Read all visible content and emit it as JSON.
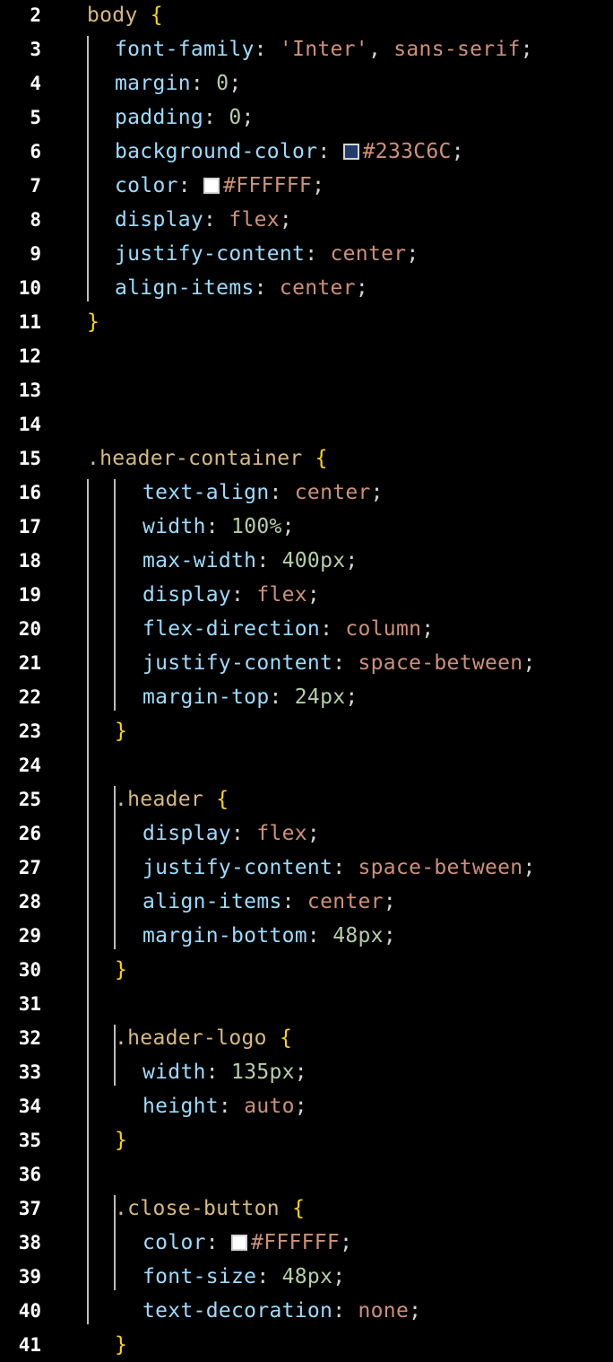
{
  "colors": {
    "background": "#000000",
    "line_number": "#ffffff",
    "selector": "#d7ba7d",
    "brace": "#ffd700",
    "property": "#9cdcfe",
    "punctuation": "#d4d4d4",
    "value": "#ce9178",
    "number": "#b5cea8",
    "guide": "#bdbdbd"
  },
  "lines": [
    {
      "n": "2",
      "indent": 0,
      "tokens": [
        {
          "t": "sel",
          "v": "body"
        },
        {
          "t": "text",
          "v": " "
        },
        {
          "t": "brace",
          "v": "{"
        }
      ]
    },
    {
      "n": "3",
      "indent": 1,
      "tokens": [
        {
          "t": "prop",
          "v": "font-family"
        },
        {
          "t": "punc",
          "v": ": "
        },
        {
          "t": "val",
          "v": "'Inter'"
        },
        {
          "t": "punc",
          "v": ", "
        },
        {
          "t": "val",
          "v": "sans-serif"
        },
        {
          "t": "punc",
          "v": ";"
        }
      ]
    },
    {
      "n": "4",
      "indent": 1,
      "tokens": [
        {
          "t": "prop",
          "v": "margin"
        },
        {
          "t": "punc",
          "v": ": "
        },
        {
          "t": "num",
          "v": "0"
        },
        {
          "t": "punc",
          "v": ";"
        }
      ]
    },
    {
      "n": "5",
      "indent": 1,
      "tokens": [
        {
          "t": "prop",
          "v": "padding"
        },
        {
          "t": "punc",
          "v": ": "
        },
        {
          "t": "num",
          "v": "0"
        },
        {
          "t": "punc",
          "v": ";"
        }
      ]
    },
    {
      "n": "6",
      "indent": 1,
      "tokens": [
        {
          "t": "prop",
          "v": "background-color"
        },
        {
          "t": "punc",
          "v": ": "
        },
        {
          "t": "swatch",
          "v": "#233C6C"
        },
        {
          "t": "val",
          "v": "#233C6C"
        },
        {
          "t": "punc",
          "v": ";"
        }
      ]
    },
    {
      "n": "7",
      "indent": 1,
      "tokens": [
        {
          "t": "prop",
          "v": "color"
        },
        {
          "t": "punc",
          "v": ": "
        },
        {
          "t": "swatch",
          "v": "#FFFFFF"
        },
        {
          "t": "val",
          "v": "#FFFFFF"
        },
        {
          "t": "punc",
          "v": ";"
        }
      ]
    },
    {
      "n": "8",
      "indent": 1,
      "tokens": [
        {
          "t": "prop",
          "v": "display"
        },
        {
          "t": "punc",
          "v": ": "
        },
        {
          "t": "val",
          "v": "flex"
        },
        {
          "t": "punc",
          "v": ";"
        }
      ]
    },
    {
      "n": "9",
      "indent": 1,
      "tokens": [
        {
          "t": "prop",
          "v": "justify-content"
        },
        {
          "t": "punc",
          "v": ": "
        },
        {
          "t": "val",
          "v": "center"
        },
        {
          "t": "punc",
          "v": ";"
        }
      ]
    },
    {
      "n": "10",
      "indent": 1,
      "tokens": [
        {
          "t": "prop",
          "v": "align-items"
        },
        {
          "t": "punc",
          "v": ": "
        },
        {
          "t": "val",
          "v": "center"
        },
        {
          "t": "punc",
          "v": ";"
        }
      ]
    },
    {
      "n": "11",
      "indent": 0,
      "tokens": [
        {
          "t": "brace",
          "v": "}"
        }
      ]
    },
    {
      "n": "12",
      "indent": 0,
      "tokens": []
    },
    {
      "n": "13",
      "indent": 0,
      "tokens": []
    },
    {
      "n": "14",
      "indent": 0,
      "tokens": []
    },
    {
      "n": "15",
      "indent": 0,
      "tokens": [
        {
          "t": "sel",
          "v": ".header-container"
        },
        {
          "t": "text",
          "v": " "
        },
        {
          "t": "brace",
          "v": "{"
        }
      ]
    },
    {
      "n": "16",
      "indent": 2,
      "tokens": [
        {
          "t": "prop",
          "v": "text-align"
        },
        {
          "t": "punc",
          "v": ": "
        },
        {
          "t": "val",
          "v": "center"
        },
        {
          "t": "punc",
          "v": ";"
        }
      ]
    },
    {
      "n": "17",
      "indent": 2,
      "tokens": [
        {
          "t": "prop",
          "v": "width"
        },
        {
          "t": "punc",
          "v": ": "
        },
        {
          "t": "num",
          "v": "100%"
        },
        {
          "t": "punc",
          "v": ";"
        }
      ]
    },
    {
      "n": "18",
      "indent": 2,
      "tokens": [
        {
          "t": "prop",
          "v": "max-width"
        },
        {
          "t": "punc",
          "v": ": "
        },
        {
          "t": "num",
          "v": "400px"
        },
        {
          "t": "punc",
          "v": ";"
        }
      ]
    },
    {
      "n": "19",
      "indent": 2,
      "tokens": [
        {
          "t": "prop",
          "v": "display"
        },
        {
          "t": "punc",
          "v": ": "
        },
        {
          "t": "val",
          "v": "flex"
        },
        {
          "t": "punc",
          "v": ";"
        }
      ]
    },
    {
      "n": "20",
      "indent": 2,
      "tokens": [
        {
          "t": "prop",
          "v": "flex-direction"
        },
        {
          "t": "punc",
          "v": ": "
        },
        {
          "t": "val",
          "v": "column"
        },
        {
          "t": "punc",
          "v": ";"
        }
      ]
    },
    {
      "n": "21",
      "indent": 2,
      "tokens": [
        {
          "t": "prop",
          "v": "justify-content"
        },
        {
          "t": "punc",
          "v": ": "
        },
        {
          "t": "val",
          "v": "space-between"
        },
        {
          "t": "punc",
          "v": ";"
        }
      ]
    },
    {
      "n": "22",
      "indent": 2,
      "tokens": [
        {
          "t": "prop",
          "v": "margin-top"
        },
        {
          "t": "punc",
          "v": ": "
        },
        {
          "t": "num",
          "v": "24px"
        },
        {
          "t": "punc",
          "v": ";"
        }
      ]
    },
    {
      "n": "23",
      "indent": 1,
      "tokens": [
        {
          "t": "brace",
          "v": "}"
        }
      ]
    },
    {
      "n": "24",
      "indent": 0,
      "tokens": []
    },
    {
      "n": "25",
      "indent": 1,
      "tokens": [
        {
          "t": "sel",
          "v": ".header"
        },
        {
          "t": "text",
          "v": " "
        },
        {
          "t": "brace",
          "v": "{"
        }
      ]
    },
    {
      "n": "26",
      "indent": 2,
      "tokens": [
        {
          "t": "prop",
          "v": "display"
        },
        {
          "t": "punc",
          "v": ": "
        },
        {
          "t": "val",
          "v": "flex"
        },
        {
          "t": "punc",
          "v": ";"
        }
      ]
    },
    {
      "n": "27",
      "indent": 2,
      "tokens": [
        {
          "t": "prop",
          "v": "justify-content"
        },
        {
          "t": "punc",
          "v": ": "
        },
        {
          "t": "val",
          "v": "space-between"
        },
        {
          "t": "punc",
          "v": ";"
        }
      ]
    },
    {
      "n": "28",
      "indent": 2,
      "tokens": [
        {
          "t": "prop",
          "v": "align-items"
        },
        {
          "t": "punc",
          "v": ": "
        },
        {
          "t": "val",
          "v": "center"
        },
        {
          "t": "punc",
          "v": ";"
        }
      ]
    },
    {
      "n": "29",
      "indent": 2,
      "tokens": [
        {
          "t": "prop",
          "v": "margin-bottom"
        },
        {
          "t": "punc",
          "v": ": "
        },
        {
          "t": "num",
          "v": "48px"
        },
        {
          "t": "punc",
          "v": ";"
        }
      ]
    },
    {
      "n": "30",
      "indent": 1,
      "tokens": [
        {
          "t": "brace",
          "v": "}"
        }
      ]
    },
    {
      "n": "31",
      "indent": 0,
      "tokens": []
    },
    {
      "n": "32",
      "indent": 1,
      "tokens": [
        {
          "t": "sel",
          "v": ".header-logo"
        },
        {
          "t": "text",
          "v": " "
        },
        {
          "t": "brace",
          "v": "{"
        }
      ]
    },
    {
      "n": "33",
      "indent": 2,
      "tokens": [
        {
          "t": "prop",
          "v": "width"
        },
        {
          "t": "punc",
          "v": ": "
        },
        {
          "t": "num",
          "v": "135px"
        },
        {
          "t": "punc",
          "v": ";"
        }
      ]
    },
    {
      "n": "34",
      "indent": 2,
      "tokens": [
        {
          "t": "prop",
          "v": "height"
        },
        {
          "t": "punc",
          "v": ": "
        },
        {
          "t": "val",
          "v": "auto"
        },
        {
          "t": "punc",
          "v": ";"
        }
      ]
    },
    {
      "n": "35",
      "indent": 1,
      "tokens": [
        {
          "t": "brace",
          "v": "}"
        }
      ]
    },
    {
      "n": "36",
      "indent": 0,
      "tokens": []
    },
    {
      "n": "37",
      "indent": 1,
      "tokens": [
        {
          "t": "sel",
          "v": ".close-button"
        },
        {
          "t": "text",
          "v": " "
        },
        {
          "t": "brace",
          "v": "{"
        }
      ]
    },
    {
      "n": "38",
      "indent": 2,
      "tokens": [
        {
          "t": "prop",
          "v": "color"
        },
        {
          "t": "punc",
          "v": ": "
        },
        {
          "t": "swatch",
          "v": "#FFFFFF"
        },
        {
          "t": "val",
          "v": "#FFFFFF"
        },
        {
          "t": "punc",
          "v": ";"
        }
      ]
    },
    {
      "n": "39",
      "indent": 2,
      "tokens": [
        {
          "t": "prop",
          "v": "font-size"
        },
        {
          "t": "punc",
          "v": ": "
        },
        {
          "t": "num",
          "v": "48px"
        },
        {
          "t": "punc",
          "v": ";"
        }
      ]
    },
    {
      "n": "40",
      "indent": 2,
      "tokens": [
        {
          "t": "prop",
          "v": "text-decoration"
        },
        {
          "t": "punc",
          "v": ": "
        },
        {
          "t": "val",
          "v": "none"
        },
        {
          "t": "punc",
          "v": ";"
        }
      ]
    },
    {
      "n": "41",
      "indent": 1,
      "tokens": [
        {
          "t": "brace",
          "v": "}"
        }
      ]
    }
  ]
}
